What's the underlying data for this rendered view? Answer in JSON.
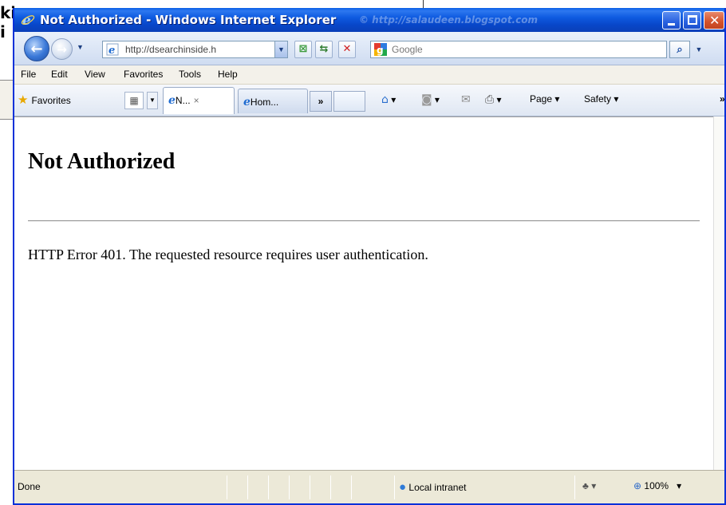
{
  "background": {
    "partial_text": "ki\ni"
  },
  "window": {
    "title": "Not Authorized - Windows Internet Explorer",
    "watermark": "© http://salaudeen.blogspot.com"
  },
  "nav": {
    "address_value": "http://dsearchinside.h",
    "search_placeholder": "Google"
  },
  "menu": {
    "items": [
      "File",
      "Edit",
      "View",
      "Favorites",
      "Tools",
      "Help"
    ]
  },
  "favorites_bar": {
    "favorites_label": "Favorites",
    "tabs": [
      {
        "label": "N...",
        "close": "×"
      },
      {
        "label": "Hom..."
      }
    ],
    "more_tabs": "»",
    "page_menu": "Page ▾",
    "safety_menu": "Safety ▾"
  },
  "page": {
    "heading": "Not Authorized",
    "message": "HTTP Error 401. The requested resource requires user authentication."
  },
  "status_bar": {
    "status": "Done",
    "zone": "Local intranet",
    "zoom": "100%"
  },
  "colors": {
    "title_bar": "#0a5fe6",
    "close_button": "#d3512a",
    "chrome": "#ece9d8"
  }
}
